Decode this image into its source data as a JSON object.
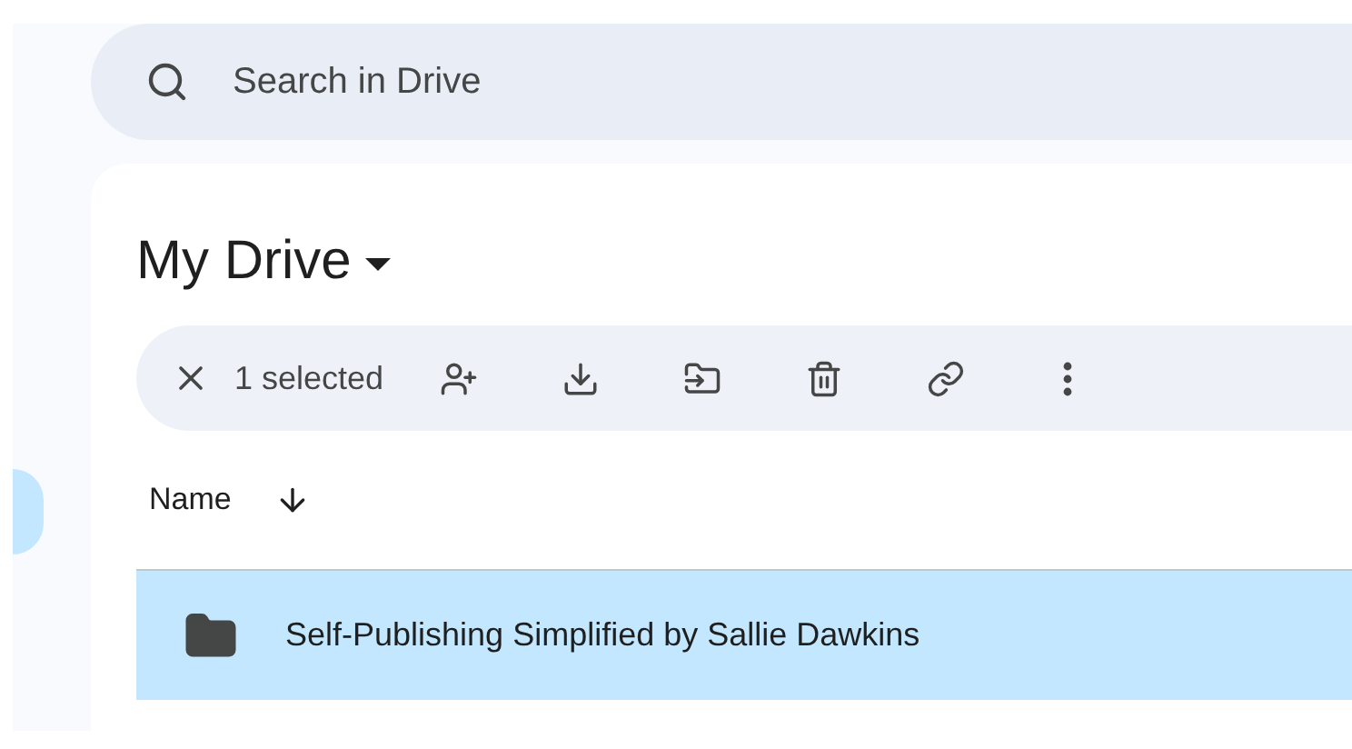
{
  "search": {
    "placeholder": "Search in Drive"
  },
  "title": "My Drive",
  "selection_bar": {
    "label": "1 selected"
  },
  "table": {
    "columns": [
      {
        "label": "Name"
      }
    ],
    "rows": [
      {
        "name": "Self-Publishing Simplified by Sallie Dawkins",
        "selected": true
      }
    ]
  }
}
